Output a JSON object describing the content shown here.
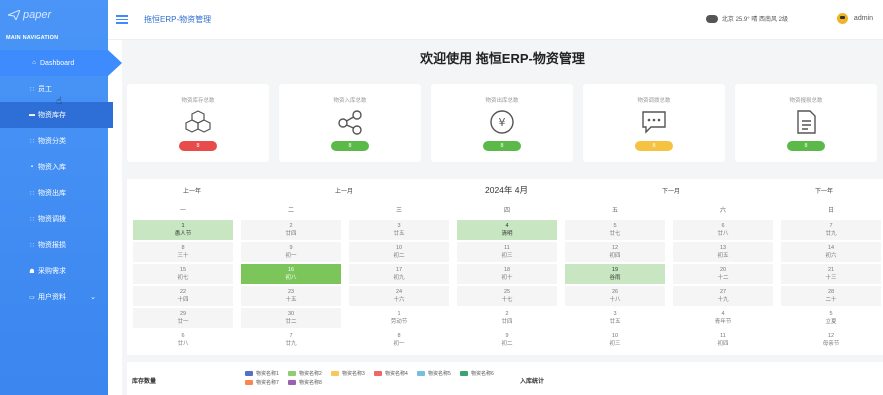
{
  "app": {
    "logo": "paper",
    "nav_title": "MAIN NAVIGATION",
    "header_title": "拖恒ERP-物资管理",
    "weather": "北京  25.9°  晴  西南风  2级",
    "user": "admin"
  },
  "sidebar": {
    "items": [
      {
        "label": "Dashboard",
        "icon": "home-icon"
      },
      {
        "label": "员工",
        "icon": "grid-icon"
      },
      {
        "label": "物资库存",
        "icon": "box-icon"
      },
      {
        "label": "物资分类",
        "icon": "grid-icon"
      },
      {
        "label": "物资入库",
        "icon": "lock-icon"
      },
      {
        "label": "物资出库",
        "icon": "grid-icon"
      },
      {
        "label": "物资调拨",
        "icon": "grid-icon"
      },
      {
        "label": "物资报损",
        "icon": "grid-icon"
      },
      {
        "label": "采购需求",
        "icon": "user-icon"
      },
      {
        "label": "用户资料",
        "icon": "folder-icon"
      }
    ]
  },
  "main": {
    "welcome": "欢迎使用 拖恒ERP-物资管理",
    "cards": [
      {
        "title": "物资库存总数",
        "value": "8",
        "color": "#e84b4b",
        "icon": "cubes-icon"
      },
      {
        "title": "物资入库总数",
        "value": "8",
        "color": "#5bb94a",
        "icon": "share-icon"
      },
      {
        "title": "物资出库总数",
        "value": "8",
        "color": "#5bb94a",
        "icon": "yen-icon"
      },
      {
        "title": "物资调拨总数",
        "value": "8",
        "color": "#f5c242",
        "icon": "chat-icon"
      },
      {
        "title": "物资报损总数",
        "value": "8",
        "color": "#5bb94a",
        "icon": "document-icon"
      }
    ]
  },
  "calendar": {
    "prev_year": "上一年",
    "prev_month": "上一月",
    "title": "2024年 4月",
    "next_month": "下一月",
    "next_year": "下一年",
    "weekdays": [
      "一",
      "二",
      "三",
      "四",
      "五",
      "六",
      "日"
    ],
    "cells": [
      {
        "d": "1",
        "l": "愚人节",
        "s": "green"
      },
      {
        "d": "2",
        "l": "廿四",
        "s": ""
      },
      {
        "d": "3",
        "l": "廿五",
        "s": ""
      },
      {
        "d": "4",
        "l": "清明",
        "s": "green"
      },
      {
        "d": "5",
        "l": "廿七",
        "s": ""
      },
      {
        "d": "6",
        "l": "廿八",
        "s": ""
      },
      {
        "d": "7",
        "l": "廿九",
        "s": ""
      },
      {
        "d": "8",
        "l": "三十",
        "s": ""
      },
      {
        "d": "9",
        "l": "初一",
        "s": ""
      },
      {
        "d": "10",
        "l": "初二",
        "s": ""
      },
      {
        "d": "11",
        "l": "初三",
        "s": ""
      },
      {
        "d": "12",
        "l": "初四",
        "s": ""
      },
      {
        "d": "13",
        "l": "初五",
        "s": ""
      },
      {
        "d": "14",
        "l": "初六",
        "s": ""
      },
      {
        "d": "15",
        "l": "初七",
        "s": ""
      },
      {
        "d": "16",
        "l": "初八",
        "s": "dark"
      },
      {
        "d": "17",
        "l": "初九",
        "s": ""
      },
      {
        "d": "18",
        "l": "初十",
        "s": ""
      },
      {
        "d": "19",
        "l": "谷雨",
        "s": "green"
      },
      {
        "d": "20",
        "l": "十二",
        "s": ""
      },
      {
        "d": "21",
        "l": "十三",
        "s": ""
      },
      {
        "d": "22",
        "l": "十四",
        "s": ""
      },
      {
        "d": "23",
        "l": "十五",
        "s": ""
      },
      {
        "d": "24",
        "l": "十六",
        "s": ""
      },
      {
        "d": "25",
        "l": "十七",
        "s": ""
      },
      {
        "d": "26",
        "l": "十八",
        "s": ""
      },
      {
        "d": "27",
        "l": "十九",
        "s": ""
      },
      {
        "d": "28",
        "l": "二十",
        "s": ""
      },
      {
        "d": "29",
        "l": "廿一",
        "s": ""
      },
      {
        "d": "30",
        "l": "廿二",
        "s": ""
      },
      {
        "d": "1",
        "l": "劳动节",
        "s": "other"
      },
      {
        "d": "2",
        "l": "廿四",
        "s": "other"
      },
      {
        "d": "3",
        "l": "廿五",
        "s": "other"
      },
      {
        "d": "4",
        "l": "青年节",
        "s": "other"
      },
      {
        "d": "5",
        "l": "立夏",
        "s": "other"
      },
      {
        "d": "6",
        "l": "廿八",
        "s": "other"
      },
      {
        "d": "7",
        "l": "廿九",
        "s": "other"
      },
      {
        "d": "8",
        "l": "初一",
        "s": "other"
      },
      {
        "d": "9",
        "l": "初二",
        "s": "other"
      },
      {
        "d": "10",
        "l": "初三",
        "s": "other"
      },
      {
        "d": "11",
        "l": "初四",
        "s": "other"
      },
      {
        "d": "12",
        "l": "母亲节",
        "s": "other"
      }
    ]
  },
  "bottom": {
    "stock_title": "库存数量",
    "in_title": "入库统计",
    "legend": [
      {
        "name": "物资名称1",
        "color": "#5470c6"
      },
      {
        "name": "物资名称2",
        "color": "#91cc75"
      },
      {
        "name": "物资名称3",
        "color": "#fac858"
      },
      {
        "name": "物资名称4",
        "color": "#ee6666"
      },
      {
        "name": "物资名称5",
        "color": "#73c0de"
      },
      {
        "name": "物资名称6",
        "color": "#3ba272"
      },
      {
        "name": "物资名称7",
        "color": "#fc8452"
      },
      {
        "name": "物资名称8",
        "color": "#9a60b4"
      }
    ]
  }
}
